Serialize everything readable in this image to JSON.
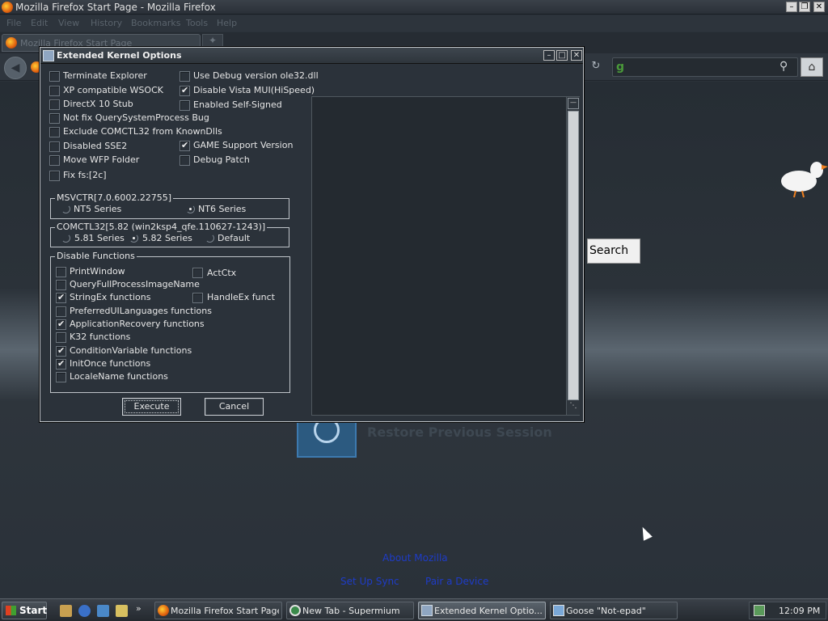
{
  "browser": {
    "window_title": "Mozilla Firefox Start Page - Mozilla Firefox",
    "menu": [
      "File",
      "Edit",
      "View",
      "History",
      "Bookmarks",
      "Tools",
      "Help"
    ],
    "tab_title": "Mozilla Firefox Start Page",
    "search_button": "Search",
    "restore_session": "Restore Previous Session",
    "footer_links": {
      "about": "About Mozilla",
      "sync": "Set Up Sync",
      "pair": "Pair a Device"
    }
  },
  "dialog": {
    "title": "Extended Kernel Options",
    "options_left": [
      {
        "label": "Terminate Explorer",
        "checked": false
      },
      {
        "label": "XP compatible WSOCK",
        "checked": false
      },
      {
        "label": "DirectX 10 Stub",
        "checked": false
      },
      {
        "label": "Not fix QuerySystemProcess Bug",
        "checked": false
      },
      {
        "label": "Exclude COMCTL32 from KnownDlls",
        "checked": false
      },
      {
        "label": "Disabled SSE2",
        "checked": false
      },
      {
        "label": "Move WFP Folder",
        "checked": false
      },
      {
        "label": "Fix fs:[2c]",
        "checked": false
      }
    ],
    "options_right": [
      {
        "label": "Use Debug version ole32.dll",
        "checked": false
      },
      {
        "label": "Disable Vista MUI(HiSpeed)",
        "checked": true
      },
      {
        "label": "Enabled Self-Signed",
        "checked": false
      },
      {
        "label": "GAME Support Version",
        "checked": true
      },
      {
        "label": "Debug Patch",
        "checked": false
      }
    ],
    "msvcrt": {
      "legend": "MSVCTR[7.0.6002.22755]",
      "options": [
        {
          "label": "NT5 Series",
          "selected": false
        },
        {
          "label": "NT6 Series",
          "selected": true
        }
      ]
    },
    "comctl": {
      "legend": "COMCTL32[5.82 (win2ksp4_qfe.110627-1243)]",
      "options": [
        {
          "label": "5.81 Series",
          "selected": false
        },
        {
          "label": "5.82 Series",
          "selected": true
        },
        {
          "label": "Default",
          "selected": false
        }
      ]
    },
    "disable_functions": {
      "legend": "Disable Functions",
      "left": [
        {
          "label": "PrintWindow",
          "checked": false
        },
        {
          "label": "QueryFullProcessImageName",
          "checked": false
        },
        {
          "label": "StringEx functions",
          "checked": true
        },
        {
          "label": "PreferredUILanguages functions",
          "checked": false
        },
        {
          "label": "ApplicationRecovery functions",
          "checked": true
        },
        {
          "label": "K32 functions",
          "checked": false
        },
        {
          "label": "ConditionVariable functions",
          "checked": true
        },
        {
          "label": "InitOnce functions",
          "checked": true
        },
        {
          "label": "LocaleName functions",
          "checked": false
        }
      ],
      "right": [
        {
          "label": "ActCtx",
          "checked": false
        },
        {
          "label": "HandleEx funct",
          "checked": false
        }
      ]
    },
    "execute": "Execute",
    "cancel": "Cancel"
  },
  "taskbar": {
    "start": "Start",
    "tasks": [
      {
        "label": "Mozilla Firefox Start Page...",
        "icon": "firefox-icon",
        "active": false
      },
      {
        "label": "New Tab - Supermium",
        "icon": "supermium-icon",
        "active": false
      },
      {
        "label": "Extended Kernel Optio...",
        "icon": "app-icon",
        "active": true
      },
      {
        "label": "Goose \"Not-epad\"",
        "icon": "notepad-icon",
        "active": false
      }
    ],
    "clock": "12:09 PM"
  }
}
